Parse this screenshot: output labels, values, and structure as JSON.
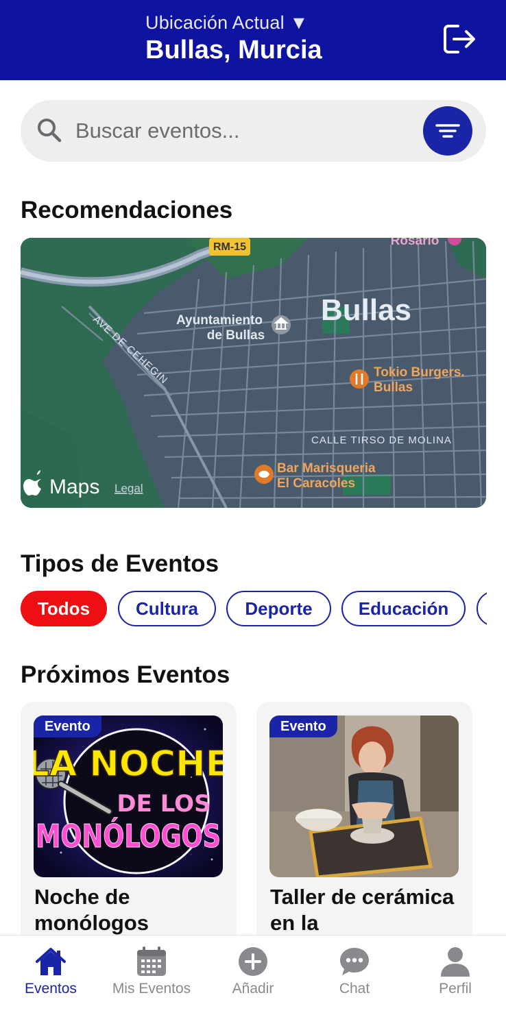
{
  "header": {
    "location_label": "Ubicación Actual ▼",
    "location_value": "Bullas, Murcia"
  },
  "search": {
    "placeholder": "Buscar eventos..."
  },
  "recommendations": {
    "title": "Recomendaciones",
    "map": {
      "town": "Bullas",
      "road_shield": "RM-15",
      "top_label": "Rosario",
      "poi_ayuntamiento_line1": "Ayuntamiento",
      "poi_ayuntamiento_line2": "de Bullas",
      "poi_tokio_line1": "Tokio Burgers.",
      "poi_tokio_line2": "Bullas",
      "poi_bar_line1": "Bar Marisqueria",
      "poi_bar_line2": "El Caracoles",
      "street_ave": "AVE DE CEHEGIN",
      "street_calle": "CALLE TIRSO DE MOLINA",
      "brand": "Maps",
      "legal": "Legal"
    }
  },
  "event_types": {
    "title": "Tipos de Eventos",
    "chips": [
      {
        "label": "Todos",
        "active": true
      },
      {
        "label": "Cultura",
        "active": false
      },
      {
        "label": "Deporte",
        "active": false
      },
      {
        "label": "Educación",
        "active": false
      }
    ]
  },
  "upcoming": {
    "title": "Próximos Eventos",
    "cards": [
      {
        "badge": "Evento",
        "title": "Noche de monólogos",
        "image_text_1": "LA NOCHE",
        "image_text_2": "DE LOS",
        "image_text_3": "MONÓLOGOS"
      },
      {
        "badge": "Evento",
        "title": "Taller de cerámica en la"
      }
    ]
  },
  "tabbar": {
    "items": [
      {
        "label": "Eventos",
        "icon": "home-icon",
        "active": true
      },
      {
        "label": "Mis Eventos",
        "icon": "calendar-icon",
        "active": false
      },
      {
        "label": "Añadir",
        "icon": "add-circle-icon",
        "active": false
      },
      {
        "label": "Chat",
        "icon": "chat-icon",
        "active": false
      },
      {
        "label": "Perfil",
        "icon": "person-icon",
        "active": false
      }
    ]
  },
  "colors": {
    "brand_blue": "#0f14a0",
    "accent_blue": "#1a24a6",
    "active_chip": "#ee0f14"
  }
}
